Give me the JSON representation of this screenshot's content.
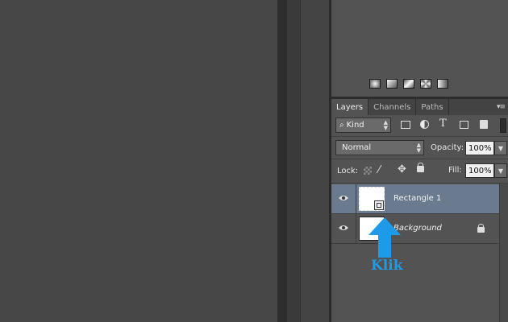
{
  "layers_panel": {
    "tabs": [
      {
        "label": "Layers",
        "active": true
      },
      {
        "label": "Channels",
        "active": false
      },
      {
        "label": "Paths",
        "active": false
      }
    ],
    "filter": {
      "kind_label": "Kind"
    },
    "blend_mode": "Normal",
    "opacity_label": "Opacity:",
    "opacity_value": "100%",
    "lock_label": "Lock:",
    "fill_label": "Fill:",
    "fill_value": "100%",
    "layers": [
      {
        "name": "Rectangle 1",
        "selected": true,
        "locked": false
      },
      {
        "name": "Background",
        "selected": false,
        "locked": true
      }
    ]
  },
  "annotation": {
    "text": "Klik",
    "color": "#1e9be8"
  },
  "colors": {
    "panel_bg": "#535353",
    "selected_layer": "#6b7b8f",
    "arrow": "#1e9be8"
  },
  "icons": {
    "gradients": [
      "gradient-radial-icon",
      "gradient-linear-icon",
      "gradient-reflected-icon",
      "gradient-diamond-icon",
      "gradient-angle-icon"
    ],
    "filters": [
      "image-filter-icon",
      "adjustment-filter-icon",
      "type-filter-icon",
      "shape-filter-icon",
      "smart-object-filter-icon"
    ],
    "locks": [
      "lock-transparent-icon",
      "lock-pixels-icon",
      "lock-position-icon",
      "lock-all-icon"
    ]
  }
}
